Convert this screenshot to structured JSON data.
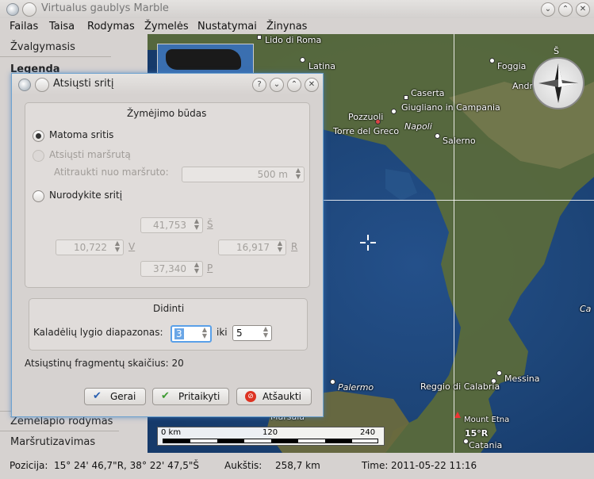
{
  "window": {
    "title": "Virtualus gaublys Marble"
  },
  "menu": {
    "items": [
      "Failas",
      "Taisa",
      "Rodymas",
      "Žymelės",
      "Nustatymai",
      "Žinynas"
    ]
  },
  "left_panel": {
    "top_tabs": [
      "Žvalgymasis",
      "Legenda"
    ],
    "bottom_tabs": [
      "Žemėlapio rodymas",
      "Maršrutizavimas"
    ]
  },
  "map": {
    "labels": [
      "Lido di Roma",
      "Latina",
      "Foggia",
      "Andr",
      "Caserta",
      "Giugliano in Campania",
      "Pozzuoli",
      "Napoli",
      "Torre del Greco",
      "Salerno",
      "Messina",
      "Palermo",
      "Reggio di Calabria",
      "Mount Etna",
      "15°R",
      "Catania",
      "Ca",
      "Marsala"
    ],
    "compass": {
      "north_label": "Š"
    },
    "scale": {
      "start": "0 km",
      "mid": "120",
      "end": "240"
    }
  },
  "status": {
    "position_label": "Pozicija:",
    "position_value": "15° 24' 46,7\"R,  38° 22' 47,5\"Š",
    "altitude_label": "Aukštis:",
    "altitude_value": "258,7 km",
    "time_label": "Time:",
    "time_value": "2011-05-22 11:16"
  },
  "dialog": {
    "title": "Atsiųsti sritį",
    "selection_group": "Žymėjimo būdas",
    "opt_visible": "Matoma sritis",
    "opt_route": "Atsiųsti maršrutą",
    "route_offset_label": "Atitraukti nuo maršruto:",
    "route_offset_value": "500 m",
    "opt_specify": "Nurodykite sritį",
    "north": {
      "value": "41,753",
      "unit": "Š"
    },
    "west": {
      "value": "10,722",
      "unit": "V"
    },
    "east": {
      "value": "16,917",
      "unit": "R"
    },
    "south": {
      "value": "37,340",
      "unit": "P"
    },
    "zoom_group": "Didinti",
    "tile_range_label": "Kaladėlių lygio diapazonas:",
    "tile_from": "3",
    "tile_to_label": "iki",
    "tile_to": "5",
    "tile_count": "Atsiųstinų fragmentų skaičius: 20",
    "ok_label": "Gerai",
    "apply_label": "Pritaikyti",
    "cancel_label": "Atšaukti"
  },
  "colors": {
    "accent": "#3d8ee0",
    "focus": "#5aa0e8"
  }
}
